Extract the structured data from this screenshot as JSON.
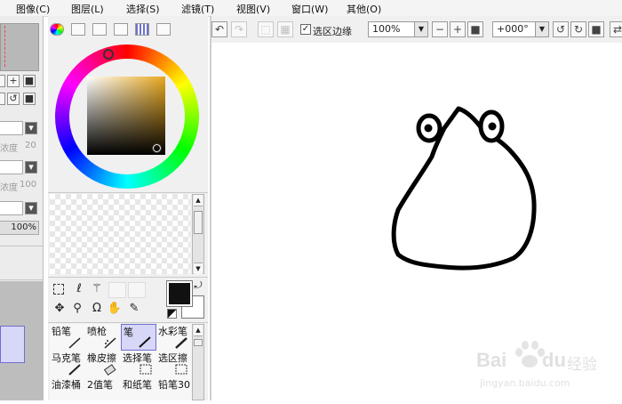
{
  "menu": {
    "items": [
      "图像(C)",
      "图层(L)",
      "选择(S)",
      "滤镜(T)",
      "视图(V)",
      "窗口(W)",
      "其他(O)"
    ]
  },
  "left_panel": {
    "label_density_1": "浓度",
    "value_density_1": "20",
    "label_density_2": "浓度",
    "value_density_2": "100",
    "percent": "100%"
  },
  "toolbar": {
    "selection_edge_label": "选区边缘",
    "selection_edge_checked": true,
    "zoom": "100%",
    "rotation": "+000°"
  },
  "colors": {
    "primary_color": "#111111",
    "secondary_color": "#ffffff",
    "selected_tool_bg": "#d7d7f7"
  },
  "brushes": [
    {
      "label": "铅笔",
      "icon": "pencil-icon"
    },
    {
      "label": "喷枪",
      "icon": "airbrush-icon"
    },
    {
      "label": "笔",
      "icon": "pen-icon",
      "selected": true
    },
    {
      "label": "水彩笔",
      "icon": "watercolor-icon"
    },
    {
      "label": "马克笔",
      "icon": "marker-icon"
    },
    {
      "label": "橡皮擦",
      "icon": "eraser-icon"
    },
    {
      "label": "选择笔",
      "icon": "select-pen-icon"
    },
    {
      "label": "选区擦",
      "icon": "select-eraser-icon"
    },
    {
      "label": "油漆桶",
      "icon": "bucket-icon"
    },
    {
      "label": "2值笔",
      "icon": "binary-pen-icon"
    },
    {
      "label": "和纸笔",
      "icon": "washi-pen-icon"
    },
    {
      "label": "铅笔30",
      "icon": "pencil30-icon"
    }
  ],
  "watermark": {
    "brand": "Bai",
    "brand2": "du",
    "brand_cn": "经验",
    "url": "jingyan.baidu.com"
  }
}
